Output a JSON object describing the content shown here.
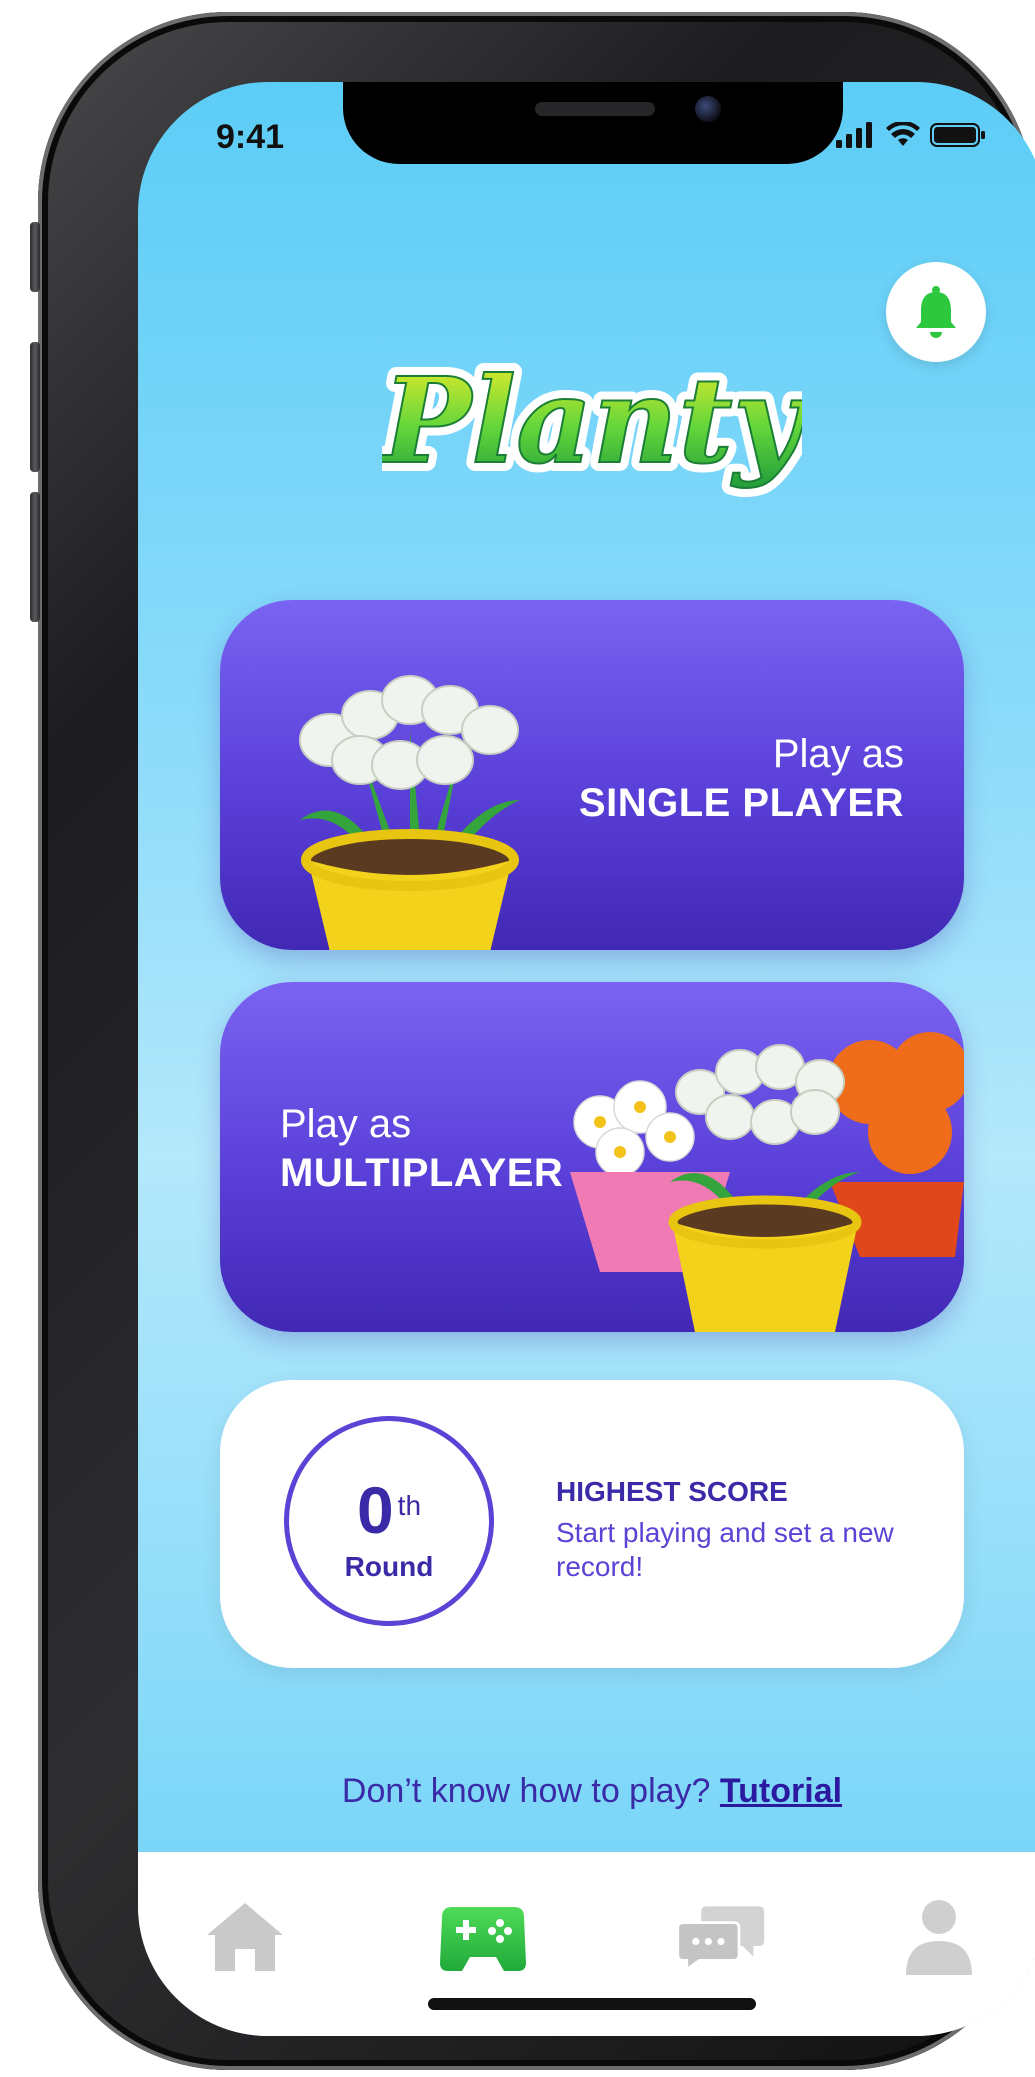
{
  "status_bar": {
    "time": "9:41"
  },
  "header": {
    "logo_text": "Planty",
    "notification_icon": "bell-icon"
  },
  "play_single": {
    "sub_label": "Play as",
    "main_label": "SINGLE PLAYER"
  },
  "play_multi": {
    "sub_label": "Play as",
    "main_label": "MULTIPLAYER"
  },
  "score": {
    "round_number": "0",
    "round_suffix": "th",
    "round_label": "Round",
    "title": "HIGHEST SCORE",
    "description": "Start playing and set a new record!"
  },
  "tutorial": {
    "prompt": "Don’t know how to play?",
    "link_label": "Tutorial"
  },
  "tabbar": {
    "items": [
      {
        "icon": "home-icon",
        "active": false
      },
      {
        "icon": "gamepad-icon",
        "active": true
      },
      {
        "icon": "chat-icon",
        "active": false
      },
      {
        "icon": "profile-icon",
        "active": false
      }
    ]
  },
  "colors": {
    "accent_purple": "#5b43d6",
    "accent_green": "#3fcf4f",
    "sky_blue": "#5ccdf7"
  }
}
